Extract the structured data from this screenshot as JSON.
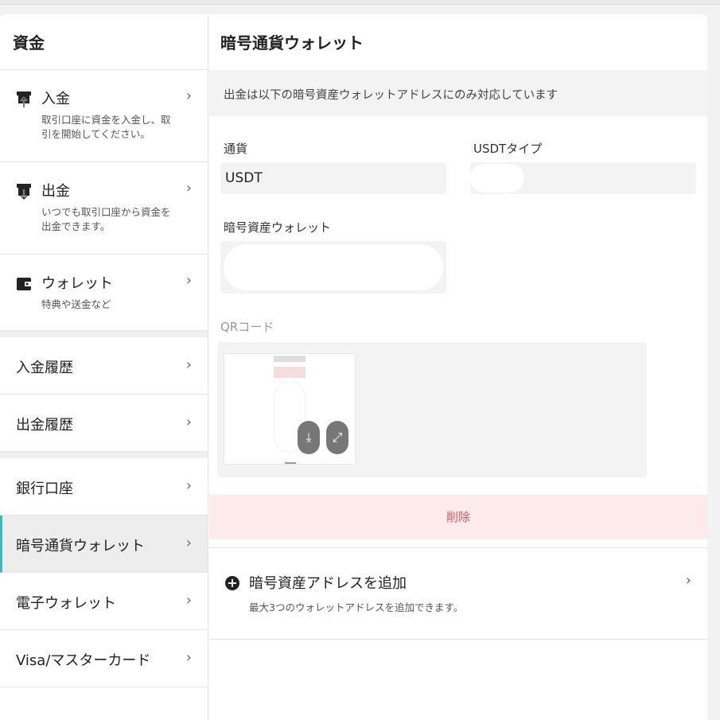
{
  "sidebar": {
    "title": "資金",
    "rich_items": [
      {
        "label": "入金",
        "desc": "取引口座に資金を入金し、取引を開始してください。",
        "icon": "deposit-icon"
      },
      {
        "label": "出金",
        "desc": "いつでも取引口座から資金を出金できます。",
        "icon": "withdraw-icon"
      },
      {
        "label": "ウォレット",
        "desc": "特典や送金など",
        "icon": "wallet-icon"
      }
    ],
    "history": [
      "入金履歴",
      "出金履歴"
    ],
    "accounts": [
      "銀行口座",
      "暗号通貨ウォレット",
      "電子ウォレット",
      "Visa/マスターカード"
    ],
    "active": "暗号通貨ウォレット"
  },
  "main": {
    "title": "暗号通貨ウォレット",
    "notice": "出金は以下の暗号資産ウォレットアドレスにのみ対応しています",
    "currency_label": "通貨",
    "currency_value": "USDT",
    "usdt_type_label": "USDTタイプ",
    "wallet_label": "暗号資産ウォレット",
    "qr_label": "QRコード",
    "delete_label": "削除",
    "add": {
      "title": "暗号資産アドレスを追加",
      "desc": "最大3つのウォレットアドレスを追加できます。"
    }
  },
  "icons": {
    "chevron": "›",
    "plus": "+",
    "download": "⤓",
    "expand": "⤢"
  },
  "colors": {
    "accent": "#3bb8c3",
    "danger_text": "#e05562",
    "danger_bg": "#fdeaea"
  }
}
